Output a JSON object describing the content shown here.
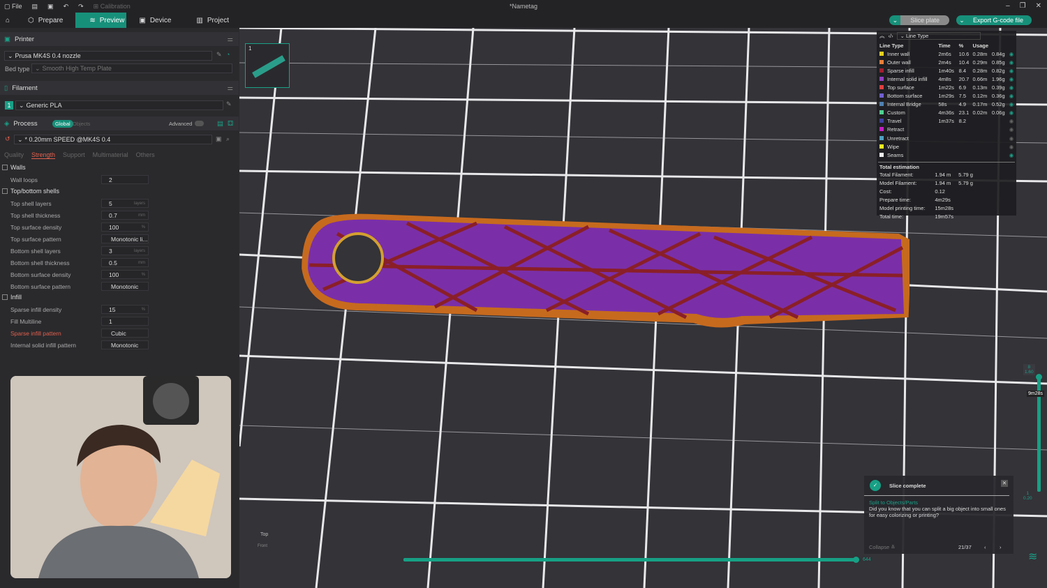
{
  "window": {
    "title": "*Nametag",
    "file": "File",
    "calibration": "Calibration"
  },
  "tabs": [
    {
      "label": "Prepare"
    },
    {
      "label": "Preview"
    },
    {
      "label": "Device"
    },
    {
      "label": "Project"
    }
  ],
  "actions": {
    "slice_plate": "Slice plate",
    "export": "Export G-code file"
  },
  "printer": {
    "header": "Printer",
    "name": "Prusa MK4S 0.4 nozzle",
    "bed_label": "Bed type",
    "bed_value": "Smooth High Temp Plate"
  },
  "filament": {
    "header": "Filament",
    "index": "1",
    "name": "Generic PLA"
  },
  "process": {
    "header": "Process",
    "global": "Global",
    "objects": "Objects",
    "advanced": "Advanced",
    "preset": "* 0.20mm SPEED @MK4S 0.4",
    "subtabs": [
      "Quality",
      "Strength",
      "Support",
      "Multimaterial",
      "Others"
    ]
  },
  "groups": {
    "walls": "Walls",
    "topbottom": "Top/bottom shells",
    "infill": "Infill"
  },
  "settings": [
    {
      "label": "Wall loops",
      "value": "2",
      "unit": ""
    },
    {
      "label": "Top shell layers",
      "value": "5",
      "unit": "layers"
    },
    {
      "label": "Top shell thickness",
      "value": "0.7",
      "unit": "mm"
    },
    {
      "label": "Top surface density",
      "value": "100",
      "unit": "%"
    },
    {
      "label": "Top surface pattern",
      "value": "Monotonic li...",
      "unit": ""
    },
    {
      "label": "Bottom shell layers",
      "value": "3",
      "unit": "layers"
    },
    {
      "label": "Bottom shell thickness",
      "value": "0.5",
      "unit": "mm"
    },
    {
      "label": "Bottom surface density",
      "value": "100",
      "unit": "%"
    },
    {
      "label": "Bottom surface pattern",
      "value": "Monotonic",
      "unit": ""
    },
    {
      "label": "Sparse infill density",
      "value": "15",
      "unit": "%"
    },
    {
      "label": "Fill Multiline",
      "value": "1",
      "unit": ""
    },
    {
      "label": "Sparse infill pattern",
      "value": "Cubic",
      "unit": ""
    },
    {
      "label": "Internal solid infill pattern",
      "value": "Monotonic",
      "unit": ""
    }
  ],
  "plate": {
    "number": "1"
  },
  "legend": {
    "view": "Line Type",
    "headers": [
      "Line Type",
      "Time",
      "%",
      "Usage"
    ],
    "rows": [
      {
        "name": "Inner wall",
        "time": "2m6s",
        "pct": "10.6",
        "m": "0.28m",
        "g": "0.84g",
        "color": "#e8d020",
        "visible": true
      },
      {
        "name": "Outer wall",
        "time": "2m4s",
        "pct": "10.4",
        "m": "0.29m",
        "g": "0.85g",
        "color": "#e8803a",
        "visible": true
      },
      {
        "name": "Sparse infill",
        "time": "1m40s",
        "pct": "8.4",
        "m": "0.28m",
        "g": "0.82g",
        "color": "#a02030",
        "visible": true
      },
      {
        "name": "Internal solid infill",
        "time": "4m8s",
        "pct": "20.7",
        "m": "0.66m",
        "g": "1.96g",
        "color": "#9040c0",
        "visible": true
      },
      {
        "name": "Top surface",
        "time": "1m22s",
        "pct": "6.9",
        "m": "0.13m",
        "g": "0.39g",
        "color": "#e04040",
        "visible": true
      },
      {
        "name": "Bottom surface",
        "time": "1m29s",
        "pct": "7.5",
        "m": "0.12m",
        "g": "0.36g",
        "color": "#7060d0",
        "visible": true
      },
      {
        "name": "Internal Bridge",
        "time": "58s",
        "pct": "4.9",
        "m": "0.17m",
        "g": "0.52g",
        "color": "#5080b0",
        "visible": true
      },
      {
        "name": "Custom",
        "time": "4m36s",
        "pct": "23.1",
        "m": "0.02m",
        "g": "0.06g",
        "color": "#50d090",
        "visible": true
      },
      {
        "name": "Travel",
        "time": "1m37s",
        "pct": "8.2",
        "m": "",
        "g": "",
        "color": "#4040a0",
        "visible": false
      },
      {
        "name": "Retract",
        "time": "",
        "pct": "",
        "m": "",
        "g": "",
        "color": "#c020c0",
        "visible": false
      },
      {
        "name": "Unretract",
        "time": "",
        "pct": "",
        "m": "",
        "g": "",
        "color": "#50a0c0",
        "visible": false
      },
      {
        "name": "Wipe",
        "time": "",
        "pct": "",
        "m": "",
        "g": "",
        "color": "#f0f020",
        "visible": false
      },
      {
        "name": "Seams",
        "time": "",
        "pct": "",
        "m": "",
        "g": "",
        "color": "#eeeeee",
        "visible": true
      }
    ],
    "total_header": "Total estimation",
    "totals": [
      {
        "label": "Total Filament:",
        "a": "1.94 m",
        "b": "5.79 g"
      },
      {
        "label": "Model Filament:",
        "a": "1.94 m",
        "b": "5.79 g"
      },
      {
        "label": "Cost:",
        "a": "0.12",
        "b": ""
      },
      {
        "label": "Prepare time:",
        "a": "4m29s",
        "b": ""
      },
      {
        "label": "Model printing time:",
        "a": "15m28s",
        "b": ""
      },
      {
        "label": "Total time:",
        "a": "19m57s",
        "b": ""
      }
    ]
  },
  "layers": {
    "top_layer": "8",
    "top_height": "1.60",
    "bottom_layer": "1",
    "bottom_height": "0.20",
    "time_tip": "9m28s",
    "move_value": "644"
  },
  "viewcube": {
    "top": "Top",
    "front": "Front"
  },
  "toast": {
    "title": "Slice complete",
    "link": "Split to Objects/Parts",
    "body": "Did you know that you can split a big object into small ones for easy colorizing or printing?",
    "collapse": "Collapse",
    "page": "21/37"
  }
}
